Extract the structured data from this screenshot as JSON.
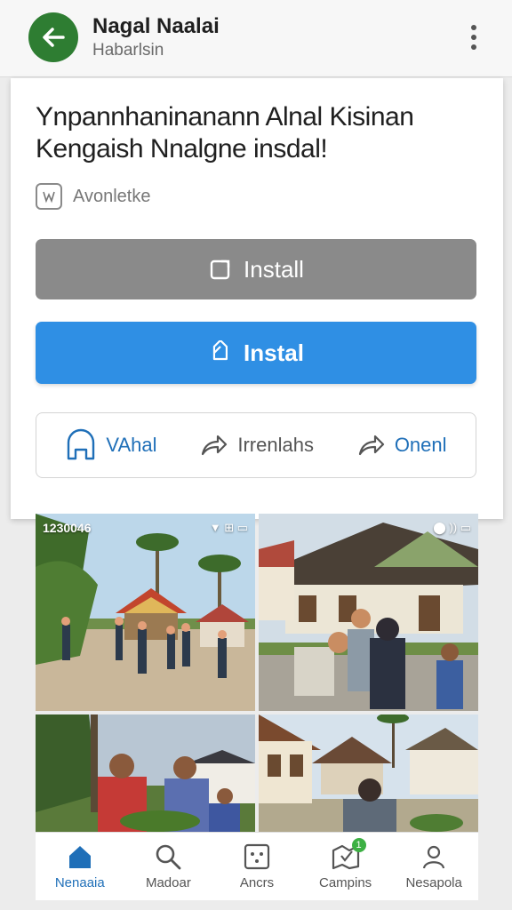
{
  "appbar": {
    "title": "Nagal Naalai",
    "subtitle": "Habarlsin"
  },
  "card": {
    "headline_line1": "Ynpannhaninanann Alnal Kisinan",
    "headline_line2": "Kengaish Nnalgne insdal!",
    "verified_label": "Avonletke",
    "install_gray_label": "Install",
    "install_blue_label": "Instal",
    "actions": [
      {
        "label": "VAhal",
        "icon": "bookmark-icon"
      },
      {
        "label": "Irrenlahs",
        "icon": "share-icon"
      },
      {
        "label": "Onenl",
        "icon": "share-icon"
      }
    ]
  },
  "gallery": {
    "status_time": "1230046",
    "status_icons_left": "▼ ⊞ ▭",
    "status_icons_right": "⬤ )) ▭"
  },
  "bottom_nav": [
    {
      "label": "Nenaaia",
      "icon": "home-icon",
      "active": true
    },
    {
      "label": "Madoar",
      "icon": "search-icon",
      "active": false
    },
    {
      "label": "Ancrs",
      "icon": "grid-icon",
      "active": false
    },
    {
      "label": "Campins",
      "icon": "map-icon",
      "active": false,
      "badge": "1"
    },
    {
      "label": "Nesapola",
      "icon": "person-icon",
      "active": false
    }
  ],
  "colors": {
    "accent_blue": "#2f8fe4",
    "back_green": "#2e7d32",
    "gray_button": "#8a8a8a"
  }
}
